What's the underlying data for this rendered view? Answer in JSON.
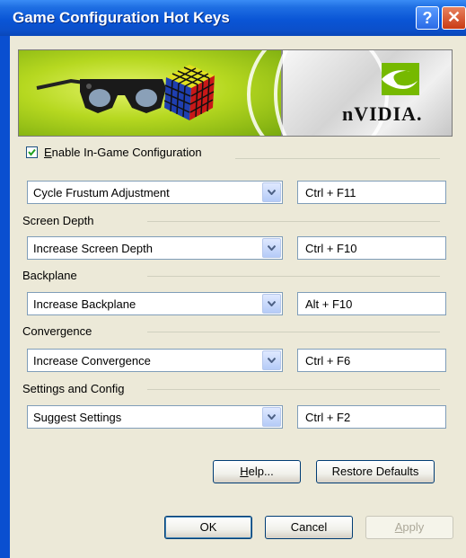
{
  "window": {
    "title": "Game Configuration Hot Keys",
    "help_glyph": "?",
    "close_glyph": "✕"
  },
  "banner": {
    "brand": "nVIDIA."
  },
  "enable_checkbox": {
    "label_underlined": "E",
    "label_rest": "nable In-Game Configuration",
    "checked": true
  },
  "rows": [
    {
      "section": "",
      "action": "Cycle Frustum Adjustment",
      "hotkey": "Ctrl + F11"
    },
    {
      "section": "Screen Depth",
      "action": "Increase Screen Depth",
      "hotkey": "Ctrl + F10"
    },
    {
      "section": "Backplane",
      "action": "Increase Backplane",
      "hotkey": "Alt + F10"
    },
    {
      "section": "Convergence",
      "action": "Increase Convergence",
      "hotkey": "Ctrl + F6"
    },
    {
      "section": "Settings and Config",
      "action": "Suggest Settings",
      "hotkey": "Ctrl + F2"
    }
  ],
  "buttons": {
    "help_u": "H",
    "help_rest": "elp...",
    "restore": "Restore Defaults",
    "ok": "OK",
    "cancel": "Cancel",
    "apply_u": "A",
    "apply_rest": "pply"
  },
  "colors": {
    "titlebar": "#0a55d6",
    "dialog_bg": "#ece9d8",
    "banner_green": "#a8cf1c"
  }
}
